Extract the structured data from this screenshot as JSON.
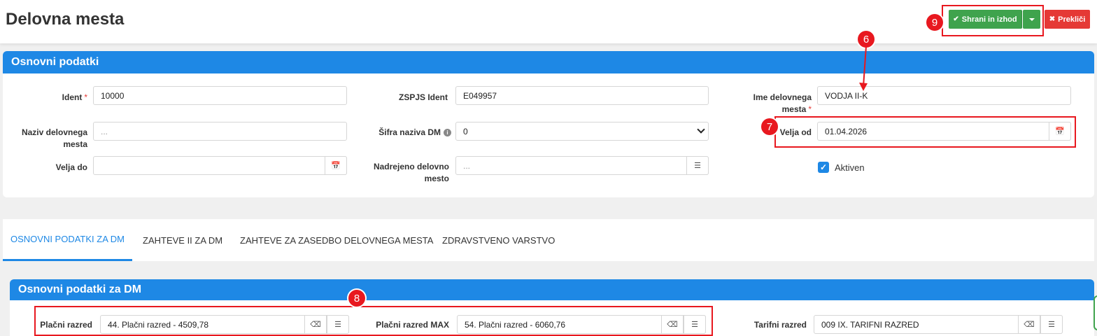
{
  "page_title": "Delovna mesta",
  "toolbar": {
    "save_label": "Shrani in izhod",
    "cancel_label": "Prekliči",
    "save_color": "#3fa34d",
    "cancel_color": "#e53935"
  },
  "section_basic": {
    "title": "Osnovni podatki",
    "ident_label": "Ident",
    "ident_value": "10000",
    "zspjs_label": "ZSPJS Ident",
    "zspjs_value": "E049957",
    "ime_label": "Ime delovnega mesta",
    "ime_value": "VODJA II-K",
    "naziv_label": "Naziv delovnega mesta",
    "naziv_placeholder": "...",
    "sifra_label": "Šifra naziva DM",
    "sifra_value": "0",
    "velja_od_label": "Velja od",
    "velja_od_value": "01.04.2026",
    "velja_do_label": "Velja do",
    "velja_do_value": "",
    "nadrejeno_label": "Nadrejeno delovno mesto",
    "nadrejeno_placeholder": "...",
    "aktiven_label": "Aktiven",
    "aktiven_checked": true
  },
  "tabs": [
    {
      "label": "OSNOVNI PODATKI ZA DM",
      "active": true
    },
    {
      "label": "ZAHTEVE II ZA DM",
      "active": false
    },
    {
      "label": "ZAHTEVE ZA ZASEDBO DELOVNEGA MESTA",
      "active": false
    },
    {
      "label": "ZDRAVSTVENO VARSTVO",
      "active": false
    }
  ],
  "section_dm": {
    "title": "Osnovni podatki za DM",
    "placni_label": "Plačni razred",
    "placni_value": "44. Plačni razred - 4509,78",
    "placni_max_label": "Plačni razred MAX",
    "placni_max_value": "54. Plačni razred - 6060,76",
    "tarifni_label": "Tarifni razred",
    "tarifni_value": "009 IX. TARIFNI RAZRED"
  },
  "annotations": {
    "m6": "6",
    "m7": "7",
    "m8": "8",
    "m9": "9",
    "color": "#e8181f"
  },
  "accent_color": "#1e88e5"
}
